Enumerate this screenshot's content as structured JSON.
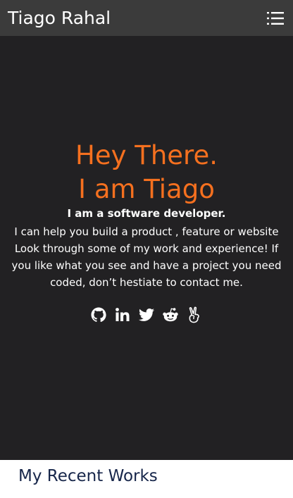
{
  "navbar": {
    "brand": "Tiago Rahal",
    "menu_icon": "hamburger-list-icon"
  },
  "hero": {
    "heading_line1": "Hey There.",
    "heading_line2": "I am Tiago",
    "subtitle": "I am a software developer.",
    "description": "I can help you build a product , feature or website Look through some of my work and experience! If you like what you see and have a project you need coded, don’t hestiate to contact me.",
    "socials": [
      {
        "icon": "github-icon"
      },
      {
        "icon": "linkedin-icon"
      },
      {
        "icon": "twitter-icon"
      },
      {
        "icon": "reddit-icon"
      },
      {
        "icon": "angellist-icon"
      }
    ]
  },
  "recent_works": {
    "title": "My Recent Works"
  },
  "colors": {
    "navbar_bg": "#3b3b3b",
    "hero_bg": "#222123",
    "accent": "#f5701f",
    "recent_title": "#17264a"
  }
}
